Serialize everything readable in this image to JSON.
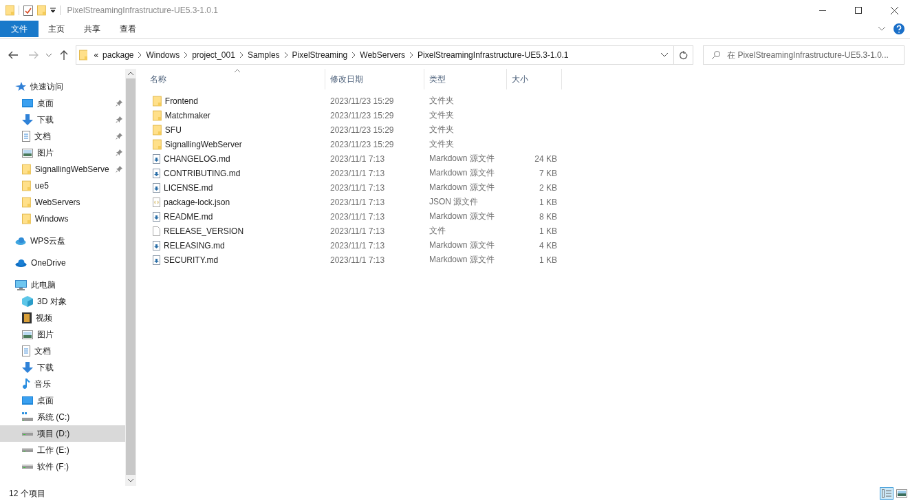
{
  "window": {
    "title": "PixelStreamingInfrastructure-UE5.3-1.0.1"
  },
  "ribbon_tabs": [
    {
      "label": "文件",
      "kind": "file"
    },
    {
      "label": "主页",
      "kind": "tab"
    },
    {
      "label": "共享",
      "kind": "tab"
    },
    {
      "label": "查看",
      "kind": "tab"
    }
  ],
  "address_bar": {
    "overflow": "«",
    "path": [
      "package",
      "Windows",
      "project_001",
      "Samples",
      "PixelStreaming",
      "WebServers",
      "PixelStreamingInfrastructure-UE5.3-1.0.1"
    ],
    "search_placeholder": "在 PixelStreamingInfrastructure-UE5.3-1.0..."
  },
  "sidebar": {
    "groups": [
      {
        "label": "快速访问",
        "kind": "star",
        "children": [
          {
            "label": "桌面",
            "kind": "desktop",
            "pinned": true,
            "selected": false
          },
          {
            "label": "下载",
            "kind": "download",
            "pinned": true,
            "selected": false
          },
          {
            "label": "文档",
            "kind": "document",
            "pinned": true,
            "selected": false
          },
          {
            "label": "图片",
            "kind": "pictures",
            "pinned": true,
            "selected": false
          },
          {
            "label": "SignallingWebServe",
            "kind": "folder",
            "pinned": true,
            "selected": false
          },
          {
            "label": "ue5",
            "kind": "folder",
            "pinned": false,
            "selected": false
          },
          {
            "label": "WebServers",
            "kind": "folder",
            "pinned": false,
            "selected": false
          },
          {
            "label": "Windows",
            "kind": "folder",
            "pinned": false,
            "selected": false
          }
        ]
      },
      {
        "label": "WPS云盘",
        "kind": "cloud"
      },
      {
        "label": "OneDrive",
        "kind": "onedrive"
      },
      {
        "label": "此电脑",
        "kind": "pc",
        "children": [
          {
            "label": "3D 对象",
            "kind": "cube",
            "pinned": false,
            "selected": false
          },
          {
            "label": "视频",
            "kind": "video",
            "pinned": false,
            "selected": false
          },
          {
            "label": "图片",
            "kind": "pictures",
            "pinned": false,
            "selected": false
          },
          {
            "label": "文档",
            "kind": "document",
            "pinned": false,
            "selected": false
          },
          {
            "label": "下载",
            "kind": "download",
            "pinned": false,
            "selected": false
          },
          {
            "label": "音乐",
            "kind": "music",
            "pinned": false,
            "selected": false
          },
          {
            "label": "桌面",
            "kind": "desktop",
            "pinned": false,
            "selected": false
          },
          {
            "label": "系统 (C:)",
            "kind": "system_drive",
            "pinned": false,
            "selected": false
          },
          {
            "label": "项目 (D:)",
            "kind": "drive",
            "pinned": false,
            "selected": true
          },
          {
            "label": "工作 (E:)",
            "kind": "drive",
            "pinned": false,
            "selected": false
          },
          {
            "label": "软件 (F:)",
            "kind": "drive",
            "pinned": false,
            "selected": false
          }
        ]
      }
    ]
  },
  "columns": [
    {
      "label": "名称",
      "sorted": true
    },
    {
      "label": "修改日期",
      "sorted": false
    },
    {
      "label": "类型",
      "sorted": false
    },
    {
      "label": "大小",
      "sorted": false
    }
  ],
  "rows": [
    {
      "kind": "folder",
      "name": "Frontend",
      "date": "2023/11/23 15:29",
      "type": "文件夹"
    },
    {
      "kind": "folder",
      "name": "Matchmaker",
      "date": "2023/11/23 15:29",
      "type": "文件夹"
    },
    {
      "kind": "folder",
      "name": "SFU",
      "date": "2023/11/23 15:29",
      "type": "文件夹"
    },
    {
      "kind": "folder",
      "name": "SignallingWebServer",
      "date": "2023/11/23 15:29",
      "type": "文件夹"
    },
    {
      "kind": "markdown",
      "name": "CHANGELOG.md",
      "date": "2023/11/1 7:13",
      "type": "Markdown 源文件",
      "size": "24 KB"
    },
    {
      "kind": "markdown",
      "name": "CONTRIBUTING.md",
      "date": "2023/11/1 7:13",
      "type": "Markdown 源文件",
      "size": "7 KB"
    },
    {
      "kind": "markdown",
      "name": "LICENSE.md",
      "date": "2023/11/1 7:13",
      "type": "Markdown 源文件",
      "size": "2 KB"
    },
    {
      "kind": "json",
      "name": "package-lock.json",
      "date": "2023/11/1 7:13",
      "type": "JSON 源文件",
      "size": "1 KB"
    },
    {
      "kind": "markdown",
      "name": "README.md",
      "date": "2023/11/1 7:13",
      "type": "Markdown 源文件",
      "size": "8 KB"
    },
    {
      "kind": "file",
      "name": "RELEASE_VERSION",
      "date": "2023/11/1 7:13",
      "type": "文件",
      "size": "1 KB"
    },
    {
      "kind": "markdown",
      "name": "RELEASING.md",
      "date": "2023/11/1 7:13",
      "type": "Markdown 源文件",
      "size": "4 KB"
    },
    {
      "kind": "markdown",
      "name": "SECURITY.md",
      "date": "2023/11/1 7:13",
      "type": "Markdown 源文件",
      "size": "1 KB"
    }
  ],
  "status_bar": {
    "count": "12 个项目",
    "views": [
      {
        "kind": "details",
        "selected": true
      },
      {
        "kind": "large_icons",
        "selected": false
      }
    ]
  }
}
